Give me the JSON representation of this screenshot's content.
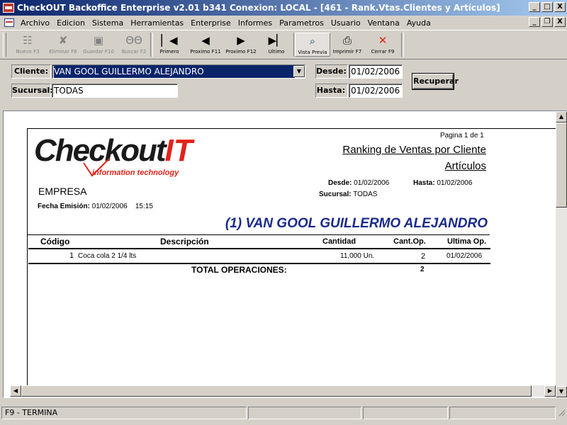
{
  "window": {
    "title": "CheckOUT Backoffice Enterprise v2.01 b341 Conexion: LOCAL - [461 - Rank.Vtas.Clientes y Artículos]",
    "controls": [
      "_",
      "□",
      "X"
    ],
    "mdi_controls": [
      "_",
      "❐",
      "X"
    ]
  },
  "menu": [
    "Archivo",
    "Edicion",
    "Sistema",
    "Herramientas",
    "Enterprise",
    "Informes",
    "Parametros",
    "Usuario",
    "Ventana",
    "Ayuda"
  ],
  "toolbar": {
    "nuevo": {
      "label": "Nuevo F3",
      "icon": "new-doc-icon",
      "enabled": false
    },
    "eliminar": {
      "label": "Eliminar F6",
      "icon": "delete-icon",
      "enabled": false
    },
    "guardar": {
      "label": "Guardar F10",
      "icon": "save-icon",
      "enabled": false
    },
    "buscar": {
      "label": "Buscar F2",
      "icon": "binoculars-icon",
      "enabled": false
    },
    "primero": {
      "label": "Primero",
      "icon": "first-icon"
    },
    "prox_f11": {
      "label": "Proximo F11",
      "icon": "prev-icon"
    },
    "prox_f12": {
      "label": "Proximo F12",
      "icon": "next-icon"
    },
    "ultimo": {
      "label": "Ultimo",
      "icon": "last-icon"
    },
    "vista": {
      "label": "Vista Previa",
      "icon": "preview-icon",
      "active": true
    },
    "imprimir": {
      "label": "Imprimir F7",
      "icon": "printer-icon"
    },
    "cerrar": {
      "label": "Cerrar F9",
      "icon": "close-icon",
      "color": "#e2231a"
    }
  },
  "filters": {
    "cliente_label": "Cliente:",
    "cliente_value": "VAN GOOL GUILLERMO ALEJANDRO",
    "sucursal_label": "Sucursal:",
    "sucursal_value": "TODAS",
    "desde_label": "Desde:",
    "desde_value": "01/02/2006",
    "hasta_label": "Hasta:",
    "hasta_value": "01/02/2006",
    "recuperar_label": "Recuperar"
  },
  "report": {
    "page_info": "Pagina 1 de 1",
    "logo_main": "Checkout",
    "logo_accent": "IT",
    "logo_tagline": "information technology",
    "title_line1": "Ranking de Ventas por Cliente",
    "title_line2": "Artículos",
    "company": "EMPRESA",
    "fecha_label": "Fecha Emisión:",
    "fecha_value": "01/02/2006",
    "hora_value": "15:15",
    "desde_label": "Desde:",
    "desde_value": "01/02/2006",
    "hasta_label": "Hasta:",
    "hasta_value": "01/02/2006",
    "sucursal_label": "Sucursal:",
    "sucursal_value": "TODAS",
    "client_heading": "(1)  VAN GOOL GUILLERMO ALEJANDRO",
    "columns": {
      "codigo": "Código",
      "descripcion": "Descripción",
      "cantidad": "Cantidad",
      "cant_op": "Cant.Op.",
      "ultima_op": "Ultima Op."
    },
    "rows": [
      {
        "codigo": "1",
        "descripcion": "Coca cola 2 1/4 lts",
        "cantidad": "11,000 Un.",
        "cant_op": "2",
        "ultima_op": "01/02/2006"
      }
    ],
    "total_label": "TOTAL OPERACIONES:",
    "total_value": "2",
    "heading_color": "#1a2a8a"
  },
  "status": {
    "left": "F9 - TERMINA"
  }
}
